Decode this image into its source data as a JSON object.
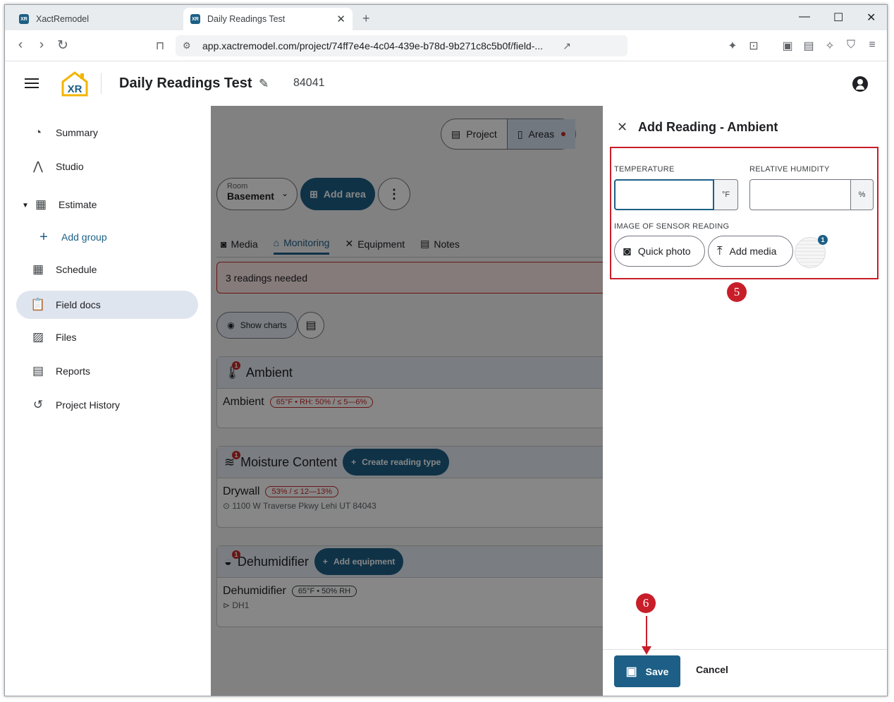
{
  "browser": {
    "tabs": [
      {
        "title": "XactRemodel",
        "favicon": "XR"
      },
      {
        "title": "Daily Readings Test",
        "favicon": "XR"
      }
    ],
    "url": "app.xactremodel.com/project/74ff7e4e-4c04-439e-b78d-9b271c8c5b0f/field-..."
  },
  "header": {
    "logo_text": "XR",
    "project_title": "Daily Readings Test",
    "project_number": "84041"
  },
  "sidebar": {
    "items": [
      {
        "label": "Summary",
        "icon": "gauge-icon"
      },
      {
        "label": "Studio",
        "icon": "compass-icon"
      },
      {
        "label": "Estimate",
        "icon": "calculator-icon"
      },
      {
        "label": "Add group",
        "icon": "plus-icon"
      },
      {
        "label": "Schedule",
        "icon": "calendar-icon"
      },
      {
        "label": "Field docs",
        "icon": "clipboard-icon"
      },
      {
        "label": "Files",
        "icon": "images-icon"
      },
      {
        "label": "Reports",
        "icon": "document-icon"
      },
      {
        "label": "Project History",
        "icon": "history-icon"
      }
    ],
    "active_item": "Field docs"
  },
  "main": {
    "segment": {
      "project": "Project",
      "areas": "Areas"
    },
    "room_selector": {
      "label": "Room",
      "value": "Basement"
    },
    "add_area": "Add area",
    "tabs": [
      "Media",
      "Monitoring",
      "Equipment",
      "Notes"
    ],
    "selected_tab": "Monitoring",
    "alert": "3 readings needed",
    "show_charts": "Show charts",
    "cards": {
      "ambient": {
        "title": "Ambient",
        "row_title": "Ambient",
        "chip": "65°F • RH: 50% / ≤ 5—6%"
      },
      "moisture": {
        "title": "Moisture Content",
        "button": "Create reading type",
        "row_title": "Drywall",
        "address": "1100 W Traverse Pkwy Lehi UT 84043",
        "chip": "53% / ≤ 12—13%"
      },
      "dehumidifier": {
        "title": "Dehumidifier",
        "button": "Add equipment",
        "row_title": "Dehumidifier",
        "chip": "65°F • 50% RH",
        "tag": "DH1"
      }
    }
  },
  "panel": {
    "title": "Add Reading - Ambient",
    "temperature_label": "TEMPERATURE",
    "temperature_value": "",
    "temperature_unit": "°F",
    "humidity_label": "RELATIVE HUMIDITY",
    "humidity_value": "",
    "humidity_unit": "%",
    "image_label": "IMAGE OF SENSOR READING",
    "quick_photo": "Quick photo",
    "add_media": "Add media",
    "media_count": "1",
    "save": "Save",
    "cancel": "Cancel"
  },
  "annotations": {
    "step_5": "5",
    "step_6": "6",
    "color": "#c81e2a"
  },
  "colors": {
    "accent": "#1d5f86",
    "alert": "#c62828"
  }
}
